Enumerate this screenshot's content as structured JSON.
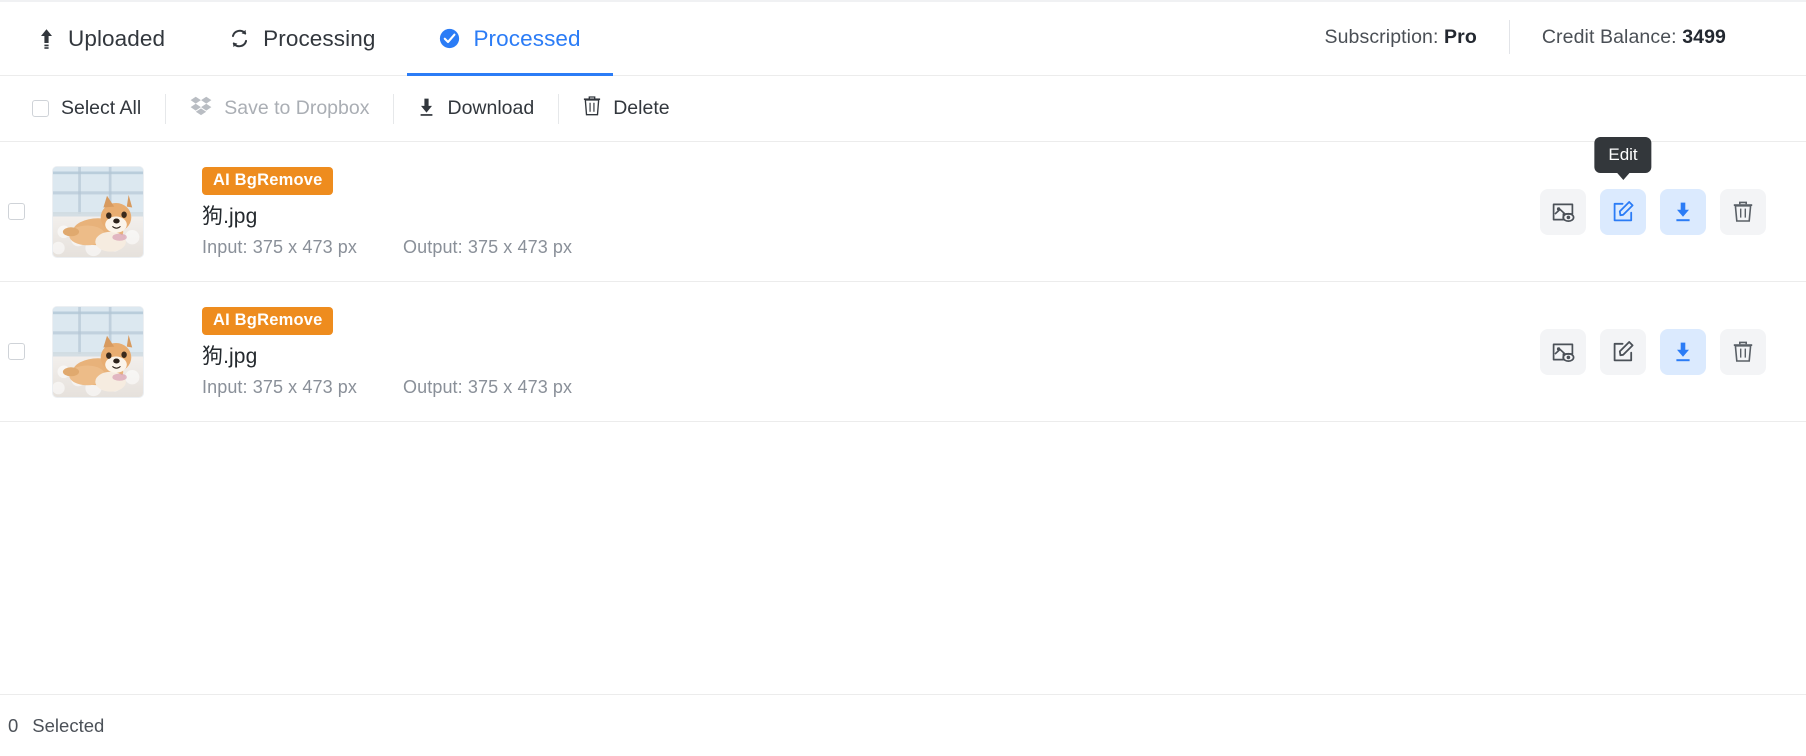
{
  "header": {
    "tabs": [
      {
        "label": "Uploaded",
        "icon": "upload-icon",
        "active": false
      },
      {
        "label": "Processing",
        "icon": "sync-icon",
        "active": false
      },
      {
        "label": "Processed",
        "icon": "check-circle-icon",
        "active": true
      }
    ],
    "subscription_label": "Subscription:",
    "subscription_value": "Pro",
    "credit_label": "Credit Balance:",
    "credit_value": "3499"
  },
  "toolbar": {
    "select_all_label": "Select All",
    "save_dropbox_label": "Save to Dropbox",
    "download_label": "Download",
    "delete_label": "Delete"
  },
  "rows": [
    {
      "badge": "AI BgRemove",
      "filename": "狗.jpg",
      "input_label": "Input: 375 x 473 px",
      "output_label": "Output: 375 x 473 px",
      "tooltip": "Edit",
      "actions": [
        {
          "name": "preview-icon",
          "highlighted": false
        },
        {
          "name": "edit-icon",
          "highlighted": true
        },
        {
          "name": "download-icon",
          "highlighted": true
        },
        {
          "name": "delete-icon",
          "highlighted": false
        }
      ]
    },
    {
      "badge": "AI BgRemove",
      "filename": "狗.jpg",
      "input_label": "Input: 375 x 473 px",
      "output_label": "Output: 375 x 473 px",
      "tooltip": "",
      "actions": [
        {
          "name": "preview-icon",
          "highlighted": false
        },
        {
          "name": "edit-icon",
          "highlighted": false
        },
        {
          "name": "download-icon",
          "highlighted": true
        },
        {
          "name": "delete-icon",
          "highlighted": false
        }
      ]
    }
  ],
  "footer": {
    "selected_count": "0",
    "selected_label": "Selected"
  },
  "colors": {
    "accent": "#2b7cf6",
    "badge": "#ee8c1e",
    "tooltip_bg": "#33373b",
    "icon_active_bg": "#dbeafe"
  }
}
